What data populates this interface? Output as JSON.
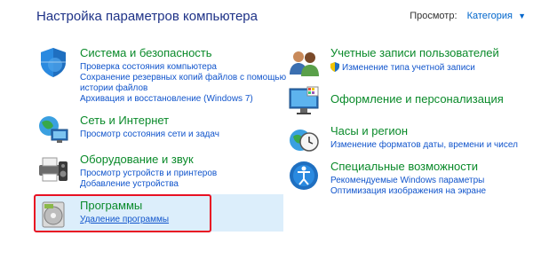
{
  "window": {
    "title": "Настройка параметров компьютера"
  },
  "view_by": {
    "label": "Просмотр:",
    "value": "Категория",
    "icon": "chevron-down-icon"
  },
  "left_categories": [
    {
      "icon": "shield-security-icon",
      "heading": "Система и безопасность",
      "links": [
        "Проверка состояния компьютера",
        "Сохранение резервных копий файлов с помощью истории файлов",
        "Архивация и восстановление (Windows 7)"
      ]
    },
    {
      "icon": "network-globe-icon",
      "heading": "Сеть и Интернет",
      "links": [
        "Просмотр состояния сети и задач"
      ]
    },
    {
      "icon": "printer-speaker-icon",
      "heading": "Оборудование и звук",
      "links": [
        "Просмотр устройств и принтеров",
        "Добавление устройства"
      ]
    },
    {
      "icon": "programs-disc-icon",
      "heading": "Программы",
      "links": [
        "Удаление программы"
      ]
    }
  ],
  "right_categories": [
    {
      "icon": "users-icon",
      "heading": "Учетные записи пользователей",
      "links": [
        "Изменение типа учетной записи"
      ],
      "link_icon": "uac-shield-icon"
    },
    {
      "icon": "appearance-monitor-icon",
      "heading": "Оформление и персонализация",
      "links": []
    },
    {
      "icon": "clock-globe-icon",
      "heading": "Часы и регион",
      "links": [
        "Изменение форматов даты, времени и чисел"
      ]
    },
    {
      "icon": "accessibility-icon",
      "heading": "Специальные возможности",
      "links": [
        "Рекомендуемые Windows параметры",
        "Оптимизация изображения на экране"
      ]
    }
  ],
  "colors": {
    "heading": "#0a8a2a",
    "link": "#1155cc",
    "title": "#1e3287",
    "highlight": "#dceefb",
    "annotation": "#e81123"
  }
}
